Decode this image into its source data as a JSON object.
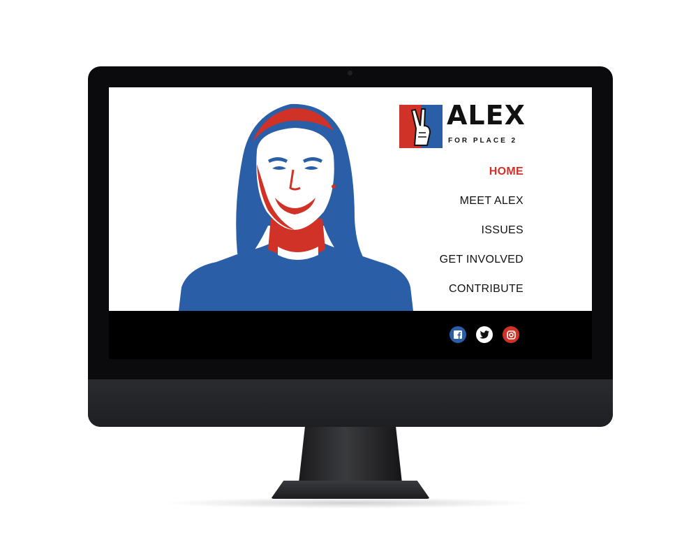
{
  "brand": {
    "name": "ALEX",
    "tagline": "FOR PLACE 2",
    "colors": {
      "red": "#d03227",
      "blue": "#2a5fa8",
      "dark": "#111111"
    }
  },
  "nav": {
    "items": [
      {
        "label": "HOME",
        "active": true
      },
      {
        "label": "MEET ALEX",
        "active": false
      },
      {
        "label": "ISSUES",
        "active": false
      },
      {
        "label": "GET INVOLVED",
        "active": false
      },
      {
        "label": "CONTRIBUTE",
        "active": false
      }
    ]
  },
  "social": [
    {
      "icon": "facebook-icon",
      "color": "#2a5fa8"
    },
    {
      "icon": "twitter-icon",
      "color": "#ffffff"
    },
    {
      "icon": "instagram-icon",
      "color": "#d03227"
    }
  ]
}
